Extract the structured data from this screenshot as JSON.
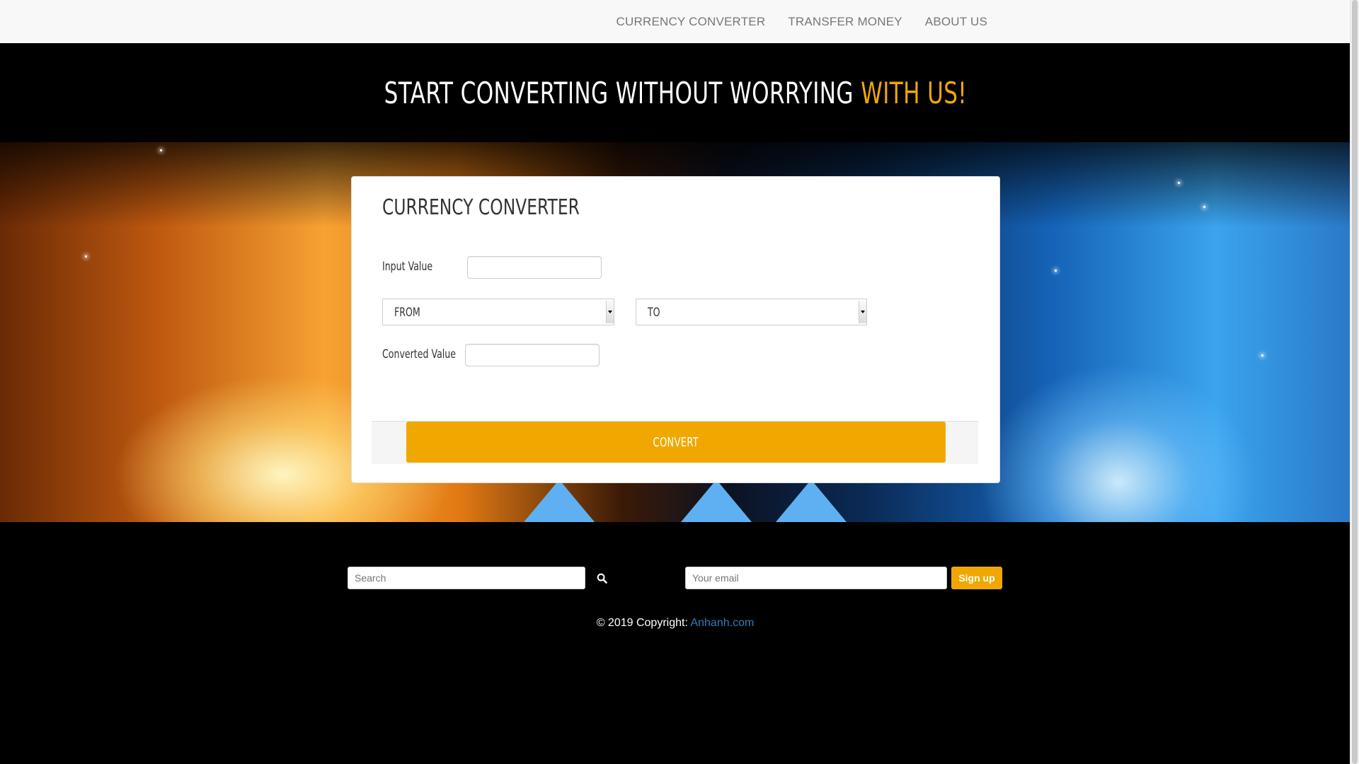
{
  "nav": {
    "items": [
      "CURRENCY CONVERTER",
      "TRANSFER MONEY",
      "ABOUT US"
    ]
  },
  "hero": {
    "title_main": "START CONVERTING WITHOUT WORRYING ",
    "title_accent": "WITH US!"
  },
  "converter": {
    "title": "CURRENCY CONVERTER",
    "input_label": "Input Value",
    "input_value": "",
    "from_select": "FROM",
    "to_select": "TO",
    "converted_label": "Converted Value",
    "converted_value": "",
    "convert_button": "CONVERT"
  },
  "footer": {
    "search_placeholder": "Search",
    "email_placeholder": "Your email",
    "signup_button": "Sign up",
    "copyright_text": "© 2019 Copyright: ",
    "copyright_link": "Anhanh.com"
  },
  "colors": {
    "accent": "#f0a800",
    "link": "#337ab7",
    "background": "#000000"
  },
  "icons": {
    "search": "search-icon"
  }
}
